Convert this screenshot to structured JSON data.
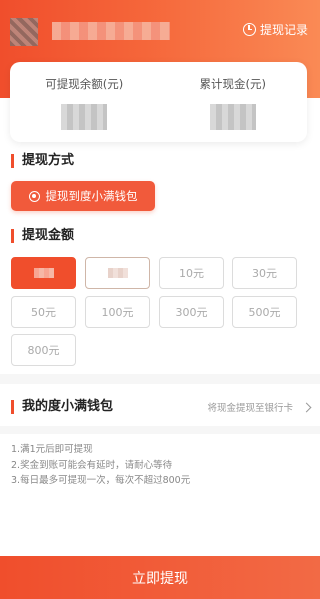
{
  "header": {
    "history_label": "提现记录"
  },
  "balance": {
    "available_label": "可提现余额(元)",
    "total_label": "累计现金(元)"
  },
  "method": {
    "title": "提现方式",
    "button_label": "提现到度小满钱包"
  },
  "amount": {
    "title": "提现金额",
    "options": [
      "10元",
      "30元",
      "50元",
      "100元",
      "300元",
      "500元",
      "800元"
    ]
  },
  "wallet": {
    "title": "我的度小满钱包",
    "hint": "将现金提现至银行卡"
  },
  "rules": [
    "1.满1元后即可提现",
    "2.奖金到账可能会有延时，请耐心等待",
    "3.每日最多可提现一次，每次不超过800元"
  ],
  "submit_label": "立即提现",
  "colors": {
    "accent": "#f04e2c",
    "accent_light": "#fa8a55"
  }
}
